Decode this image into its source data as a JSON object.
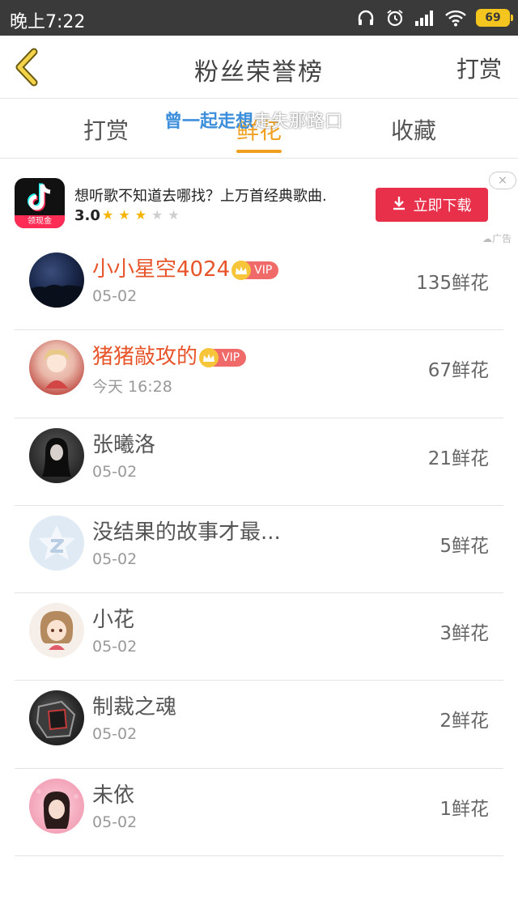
{
  "status_bar": {
    "time": "晚上7:22",
    "battery": "69",
    "icons": [
      "headphones-icon",
      "alarm-icon",
      "signal-icon",
      "wifi-icon",
      "battery-icon"
    ]
  },
  "header": {
    "title": "粉丝荣誉榜",
    "action": "打赏"
  },
  "tabs": [
    {
      "label": "打赏",
      "active": false
    },
    {
      "label": "鲜花",
      "active": true
    },
    {
      "label": "收藏",
      "active": false
    }
  ],
  "danmaku": {
    "part1": "曾一起走想",
    "part2": "走失那路口"
  },
  "ad": {
    "logo_badge": "领现金",
    "text": "想听歌不知道去哪找？上万首经典歌曲.",
    "rating": "3.0",
    "stars_filled": 3,
    "stars_total": 5,
    "button": "立即下载",
    "close": "×",
    "label": "广告"
  },
  "rankings": [
    {
      "name": "小小星空4024",
      "vip": true,
      "date": "05-02",
      "count": "135鲜花"
    },
    {
      "name": "猪猪敲攻的",
      "vip": true,
      "date": "今天 16:28",
      "count": "67鲜花"
    },
    {
      "name": "张曦洛",
      "vip": false,
      "date": "05-02",
      "count": "21鲜花"
    },
    {
      "name": "没结果的故事才最...",
      "vip": false,
      "date": "05-02",
      "count": "5鲜花"
    },
    {
      "name": "小花",
      "vip": false,
      "date": "05-02",
      "count": "3鲜花"
    },
    {
      "name": "制裁之魂",
      "vip": false,
      "date": "05-02",
      "count": "2鲜花"
    },
    {
      "name": "未依",
      "vip": false,
      "date": "05-02",
      "count": "1鲜花"
    }
  ],
  "vip_label": "VIP",
  "colors": {
    "accent": "#f0a020",
    "vip_name": "#e8542a",
    "ad_button": "#e8304b"
  }
}
